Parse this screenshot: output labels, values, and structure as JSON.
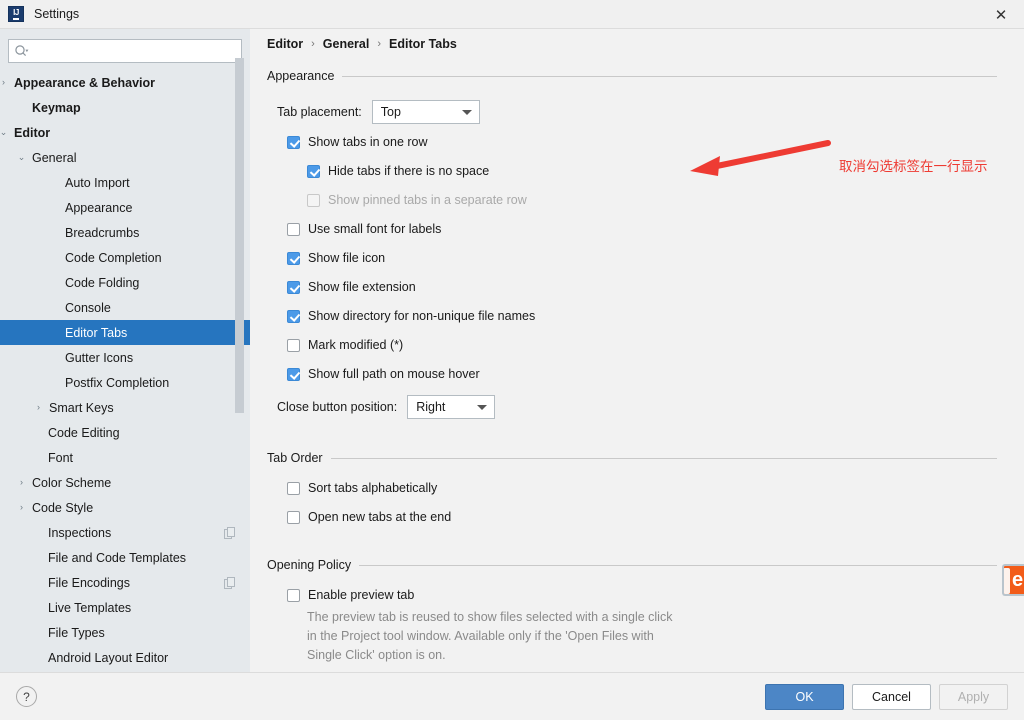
{
  "window": {
    "title": "Settings",
    "app_icon": "IJ",
    "close_icon": "✕"
  },
  "sidebar": {
    "search": {
      "placeholder": "",
      "value": "",
      "icon": "search-icon"
    },
    "items": [
      {
        "label": "Appearance & Behavior",
        "indent": 10,
        "twisty": "›",
        "bold": true,
        "selected": false,
        "badge": false
      },
      {
        "label": "Keymap",
        "indent": 28,
        "twisty": "",
        "bold": true,
        "selected": false,
        "badge": false
      },
      {
        "label": "Editor",
        "indent": 10,
        "twisty": "⌄",
        "bold": true,
        "selected": false,
        "badge": false
      },
      {
        "label": "General",
        "indent": 28,
        "twisty": "⌄",
        "bold": false,
        "selected": false,
        "badge": false
      },
      {
        "label": "Auto Import",
        "indent": 61,
        "twisty": "",
        "bold": false,
        "selected": false,
        "badge": false
      },
      {
        "label": "Appearance",
        "indent": 61,
        "twisty": "",
        "bold": false,
        "selected": false,
        "badge": false
      },
      {
        "label": "Breadcrumbs",
        "indent": 61,
        "twisty": "",
        "bold": false,
        "selected": false,
        "badge": false
      },
      {
        "label": "Code Completion",
        "indent": 61,
        "twisty": "",
        "bold": false,
        "selected": false,
        "badge": false
      },
      {
        "label": "Code Folding",
        "indent": 61,
        "twisty": "",
        "bold": false,
        "selected": false,
        "badge": false
      },
      {
        "label": "Console",
        "indent": 61,
        "twisty": "",
        "bold": false,
        "selected": false,
        "badge": false
      },
      {
        "label": "Editor Tabs",
        "indent": 61,
        "twisty": "",
        "bold": false,
        "selected": true,
        "badge": false
      },
      {
        "label": "Gutter Icons",
        "indent": 61,
        "twisty": "",
        "bold": false,
        "selected": false,
        "badge": false
      },
      {
        "label": "Postfix Completion",
        "indent": 61,
        "twisty": "",
        "bold": false,
        "selected": false,
        "badge": false
      },
      {
        "label": "Smart Keys",
        "indent": 45,
        "twisty": "›",
        "bold": false,
        "selected": false,
        "badge": false
      },
      {
        "label": "Code Editing",
        "indent": 44,
        "twisty": "",
        "bold": false,
        "selected": false,
        "badge": false
      },
      {
        "label": "Font",
        "indent": 44,
        "twisty": "",
        "bold": false,
        "selected": false,
        "badge": false
      },
      {
        "label": "Color Scheme",
        "indent": 28,
        "twisty": "›",
        "bold": false,
        "selected": false,
        "badge": false
      },
      {
        "label": "Code Style",
        "indent": 28,
        "twisty": "›",
        "bold": false,
        "selected": false,
        "badge": false
      },
      {
        "label": "Inspections",
        "indent": 44,
        "twisty": "",
        "bold": false,
        "selected": false,
        "badge": true
      },
      {
        "label": "File and Code Templates",
        "indent": 44,
        "twisty": "",
        "bold": false,
        "selected": false,
        "badge": false
      },
      {
        "label": "File Encodings",
        "indent": 44,
        "twisty": "",
        "bold": false,
        "selected": false,
        "badge": true
      },
      {
        "label": "Live Templates",
        "indent": 44,
        "twisty": "",
        "bold": false,
        "selected": false,
        "badge": false
      },
      {
        "label": "File Types",
        "indent": 44,
        "twisty": "",
        "bold": false,
        "selected": false,
        "badge": false
      },
      {
        "label": "Android Layout Editor",
        "indent": 44,
        "twisty": "",
        "bold": false,
        "selected": false,
        "badge": false
      }
    ]
  },
  "breadcrumb": {
    "part1": "Editor",
    "sep1": "›",
    "part2": "General",
    "sep2": "›",
    "part3": "Editor Tabs"
  },
  "sections": {
    "appearance": {
      "title": "Appearance"
    },
    "tab_order": {
      "title": "Tab Order"
    },
    "opening_policy": {
      "title": "Opening Policy"
    }
  },
  "controls": {
    "tab_placement": {
      "label": "Tab placement:",
      "value": "Top"
    },
    "show_tabs_one_row": {
      "label": "Show tabs in one row",
      "checked": true
    },
    "hide_tabs_no_space": {
      "label": "Hide tabs if there is no space",
      "checked": true
    },
    "show_pinned_separate_row": {
      "label": "Show pinned tabs in a separate row",
      "checked": false,
      "disabled": true
    },
    "use_small_font": {
      "label": "Use small font for labels",
      "checked": false
    },
    "show_file_icon": {
      "label": "Show file icon",
      "checked": true
    },
    "show_file_extension": {
      "label": "Show file extension",
      "checked": true
    },
    "show_directory_non_unique": {
      "label": "Show directory for non-unique file names",
      "checked": true
    },
    "mark_modified": {
      "label": "Mark modified (*)",
      "checked": false
    },
    "show_full_path_hover": {
      "label": "Show full path on mouse hover",
      "checked": true
    },
    "close_button_position": {
      "label": "Close button position:",
      "value": "Right"
    },
    "sort_tabs_alphabetically": {
      "label": "Sort tabs alphabetically",
      "checked": false
    },
    "open_new_tabs_end": {
      "label": "Open new tabs at the end",
      "checked": false
    },
    "enable_preview_tab": {
      "label": "Enable preview tab",
      "checked": false
    },
    "preview_hint_line1": "The preview tab is reused to show files selected with a single click",
    "preview_hint_line2": "in the Project tool window. Available only if the 'Open Files with",
    "preview_hint_line3": "Single Click' option is on."
  },
  "annotation": {
    "text": "取消勾选标签在一行显示",
    "color": "#ee3b33"
  },
  "footer": {
    "help_label": "?",
    "ok_label": "OK",
    "cancel_label": "Cancel",
    "apply_label": "Apply"
  },
  "colors": {
    "selection": "#2675bf",
    "checkbox_checked": "#4c9ae8",
    "ok_button": "#4c86c6",
    "annotation_red": "#ee3b33",
    "sidebar_bg": "#e5e9ec",
    "main_bg": "#f2f2f2"
  }
}
